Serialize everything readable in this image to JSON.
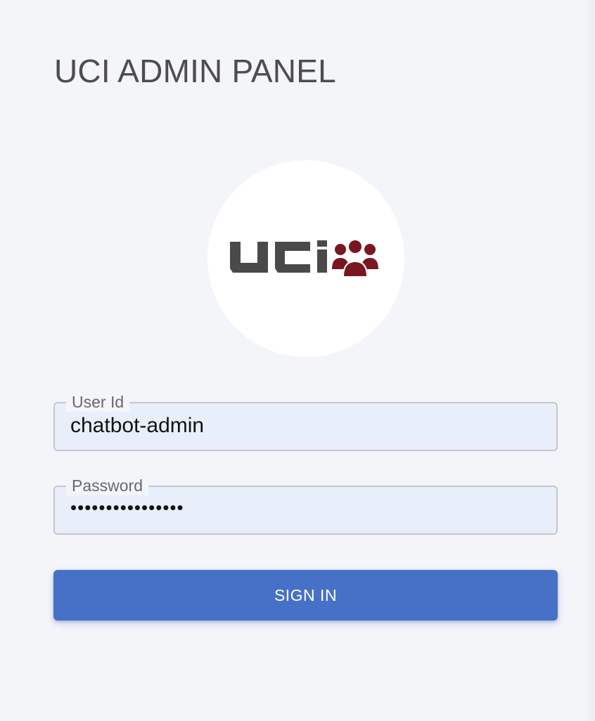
{
  "header": {
    "title": "UCI ADMIN PANEL"
  },
  "logo": {
    "text": "UCI",
    "icon": "users-group-icon",
    "text_color": "#4a4a4c",
    "icon_color": "#7a1620"
  },
  "form": {
    "user_id": {
      "label": "User Id",
      "value": "chatbot-admin"
    },
    "password": {
      "label": "Password",
      "masked_value": "••••••••••••••••"
    },
    "submit_label": "SIGN IN"
  },
  "colors": {
    "background": "#f4f5f9",
    "field_fill": "#e8effb",
    "button": "#4671c6"
  }
}
